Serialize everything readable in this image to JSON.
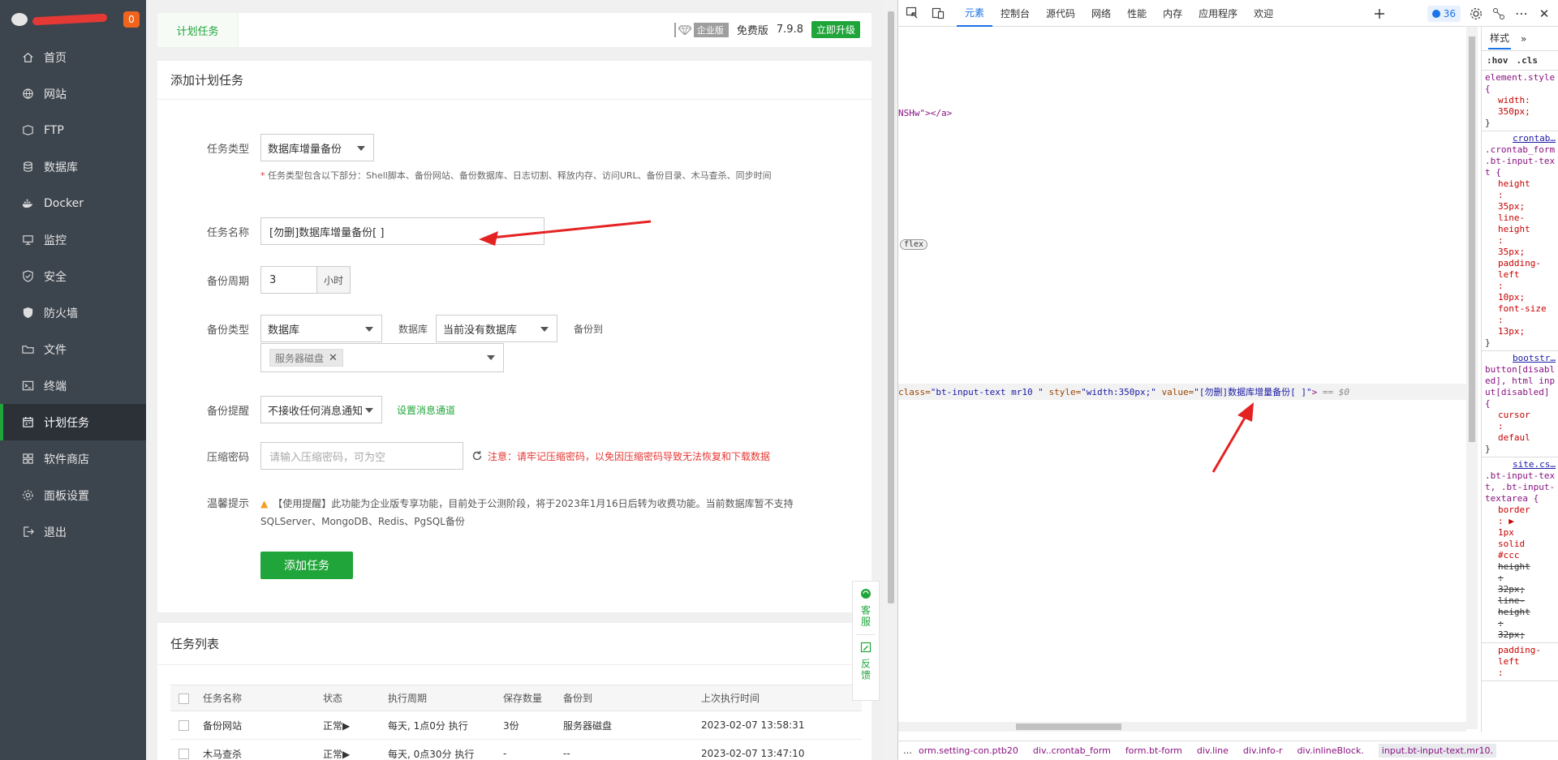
{
  "sidebar": {
    "badge": "0",
    "items": [
      {
        "label": "首页",
        "icon": "home-icon"
      },
      {
        "label": "网站",
        "icon": "globe-icon"
      },
      {
        "label": "FTP",
        "icon": "ftp-icon"
      },
      {
        "label": "数据库",
        "icon": "database-icon"
      },
      {
        "label": "Docker",
        "icon": "docker-icon"
      },
      {
        "label": "监控",
        "icon": "monitor-icon"
      },
      {
        "label": "安全",
        "icon": "shield-icon"
      },
      {
        "label": "防火墙",
        "icon": "firewall-icon"
      },
      {
        "label": "文件",
        "icon": "folder-icon"
      },
      {
        "label": "终端",
        "icon": "terminal-icon"
      },
      {
        "label": "计划任务",
        "icon": "calendar-icon"
      },
      {
        "label": "软件商店",
        "icon": "grid-icon"
      },
      {
        "label": "面板设置",
        "icon": "gear-icon"
      },
      {
        "label": "退出",
        "icon": "logout-icon"
      }
    ],
    "active_index": 10
  },
  "topbar": {
    "tab": "计划任务",
    "enterprise_label": "企业版",
    "edition": "免费版",
    "version": "7.9.8",
    "upgrade": "立即升级"
  },
  "form": {
    "title": "添加计划任务",
    "task_type_label": "任务类型",
    "task_type_value": "数据库增量备份",
    "task_type_hint": "任务类型包含以下部分：Shell脚本、备份网站、备份数据库、日志切割、释放内存、访问URL、备份目录、木马查杀、同步时间",
    "task_name_label": "任务名称",
    "task_name_value": "[勿删]数据库增量备份[  ]",
    "cycle_label": "备份周期",
    "cycle_value": "3",
    "cycle_unit": "小时",
    "backup_type_label": "备份类型",
    "backup_type_value": "数据库",
    "db_label": "数据库",
    "db_value": "当前没有数据库",
    "backup_to_label": "备份到",
    "backup_to_tag": "服务器磁盘",
    "reminder_label": "备份提醒",
    "reminder_value": "不接收任何消息通知",
    "reminder_link": "设置消息通道",
    "pwd_label": "压缩密码",
    "pwd_placeholder": "请输入压缩密码，可为空",
    "pwd_warning": "注意：请牢记压缩密码，以免因压缩密码导致无法恢复和下载数据",
    "tip_label": "温馨提示",
    "tip_line1": "【使用提醒】此功能为企业版专享功能，目前处于公测阶段，将于2023年1月16日后转为收费功能。当前数据库暂不支持",
    "tip_line2": "SQLServer、MongoDB、Redis、PgSQL备份",
    "submit": "添加任务"
  },
  "task_list": {
    "title": "任务列表",
    "columns": [
      "任务名称",
      "状态",
      "执行周期",
      "保存数量",
      "备份到",
      "上次执行时间"
    ],
    "rows": [
      {
        "name": "备份网站",
        "status": "正常▶",
        "cycle": "每天, 1点0分 执行",
        "keep": "3份",
        "dest": "服务器磁盘",
        "last": "2023-02-07 13:58:31"
      },
      {
        "name": "木马查杀",
        "status": "正常▶",
        "cycle": "每天, 0点30分 执行",
        "keep": "-",
        "dest": "--",
        "last": "2023-02-07 13:47:10"
      }
    ]
  },
  "float_help": {
    "service": "客服",
    "feedback": "反馈"
  },
  "devtools": {
    "tabs": [
      "元素",
      "控制台",
      "源代码",
      "网络",
      "性能",
      "内存",
      "应用程序",
      "欢迎"
    ],
    "issues_count": "36",
    "code_line1": "NSHw\"></a>",
    "flex": "flex",
    "sel_prefix": "class=",
    "sel_class": "\"bt-input-text mr10 \"",
    "sel_style_attr": " style=",
    "sel_style": "\"width:350px;\"",
    "sel_value_attr": " value=",
    "sel_value": "\"[勿删]数据库增量备份[  ]\"",
    "sel_end": ">",
    "sel_dollar": "== $0",
    "styles_tab": "样式",
    "hov": ":hov",
    "cls": ".cls",
    "breadcrumbs": [
      "orm.setting-con.ptb20",
      "div..crontab_form",
      "form.bt-form",
      "div.line",
      "div.info-r",
      "div.inlineBlock.",
      "input.bt-input-text.mr10."
    ],
    "style_blocks": [
      {
        "src": "",
        "sel": "element.style {",
        "props": [
          "width:",
          "350px;"
        ],
        "end": "}"
      },
      {
        "src": "crontab…",
        "sel": ".crontab_form .bt-input-text {",
        "props": [
          "height",
          ":",
          "35px;",
          "line-height",
          ":",
          "35px;",
          "padding-left",
          ":",
          "10px;",
          "font-size",
          ":",
          "13px;"
        ],
        "end": "}"
      },
      {
        "src": "bootstr…",
        "sel": "button[disabled], html input[disabled] {",
        "props": [
          "cursor",
          ":",
          "defaul"
        ],
        "end": "}"
      },
      {
        "src": "site.cs…",
        "sel": ".bt-input-text, .bt-input-textarea {",
        "props": [
          "border",
          ": ▶",
          "1px",
          "solid",
          "#ccc",
          "height",
          ":",
          "32px;",
          "line-height",
          ":",
          "32px;"
        ],
        "end": ""
      },
      {
        "src": "",
        "sel": "",
        "props": [
          "padding-left",
          ":"
        ],
        "end": ""
      }
    ]
  }
}
